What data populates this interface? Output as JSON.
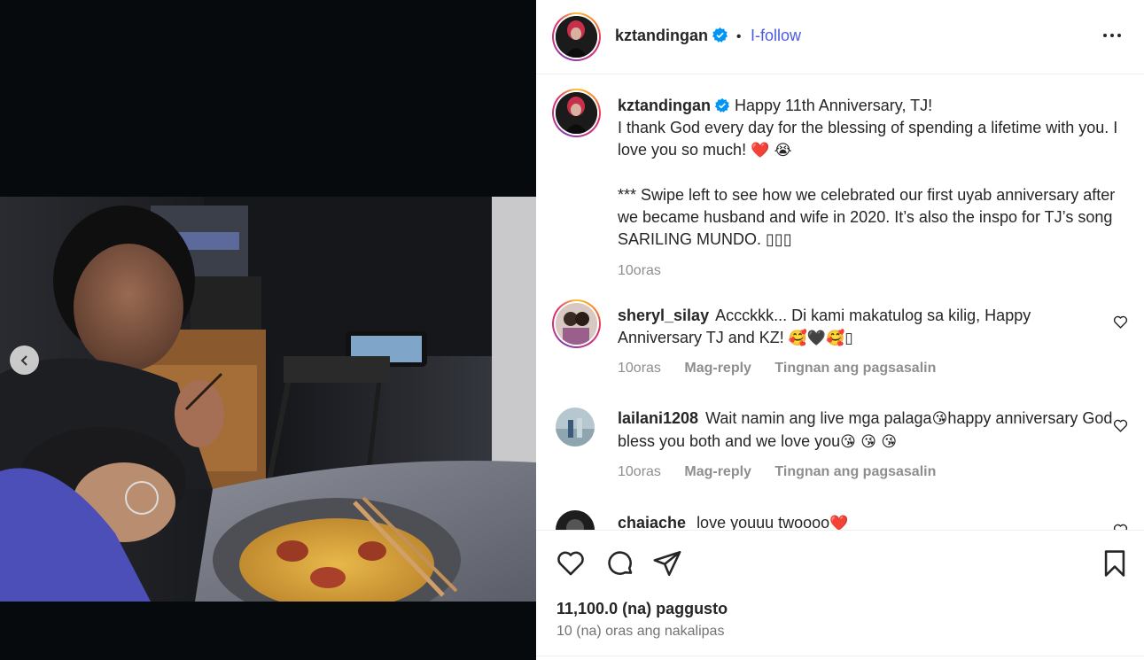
{
  "post": {
    "author": "kztandingan",
    "follow_separator": "•",
    "follow_label": "I-follow",
    "more_icon": "more-horizontal-icon",
    "verified_color": "#0095f6"
  },
  "caption": {
    "username": "kztandingan",
    "line1": "Happy 11th Anniversary, TJ!",
    "line2": "I thank God every day for the blessing of spending a lifetime with you. I love you so much!",
    "line2_emoji": "❤️ 😭",
    "line3": "*** Swipe left to see how we celebrated our first uyab anniversary after we became husband and wife in 2020. It’s also the inspo for TJ’s song SARILING MUNDO. ▯▯▯",
    "time": "10oras"
  },
  "comments": [
    {
      "username": "sheryl_silay",
      "text": "Accckkk... Di kami makatulog sa kilig, Happy Anniversary TJ and KZ!",
      "emoji": "🥰🖤🥰▯",
      "time": "10oras",
      "reply": "Mag-reply",
      "translate": "Tingnan ang pagsasalin"
    },
    {
      "username": "lailani1208",
      "text_a": "Wait namin ang live mga palaga",
      "emoji_a": "😘",
      "text_b": "happy anniversary God bless you both and we love you",
      "emoji_b": "😘 😘 😘",
      "time": "10oras",
      "reply": "Mag-reply",
      "translate": "Tingnan ang pagsasalin"
    },
    {
      "username": "chaiache",
      "text": "love youuu twoooo",
      "emoji": "❤️"
    }
  ],
  "actions": {
    "like_icon": "heart-icon",
    "comment_icon": "comment-icon",
    "share_icon": "send-icon",
    "save_icon": "bookmark-icon"
  },
  "likes": "11,100.0 (na) paggusto",
  "posted": "10 (na) oras ang nakalipas",
  "media": {
    "prev_icon": "chevron-left-icon"
  }
}
